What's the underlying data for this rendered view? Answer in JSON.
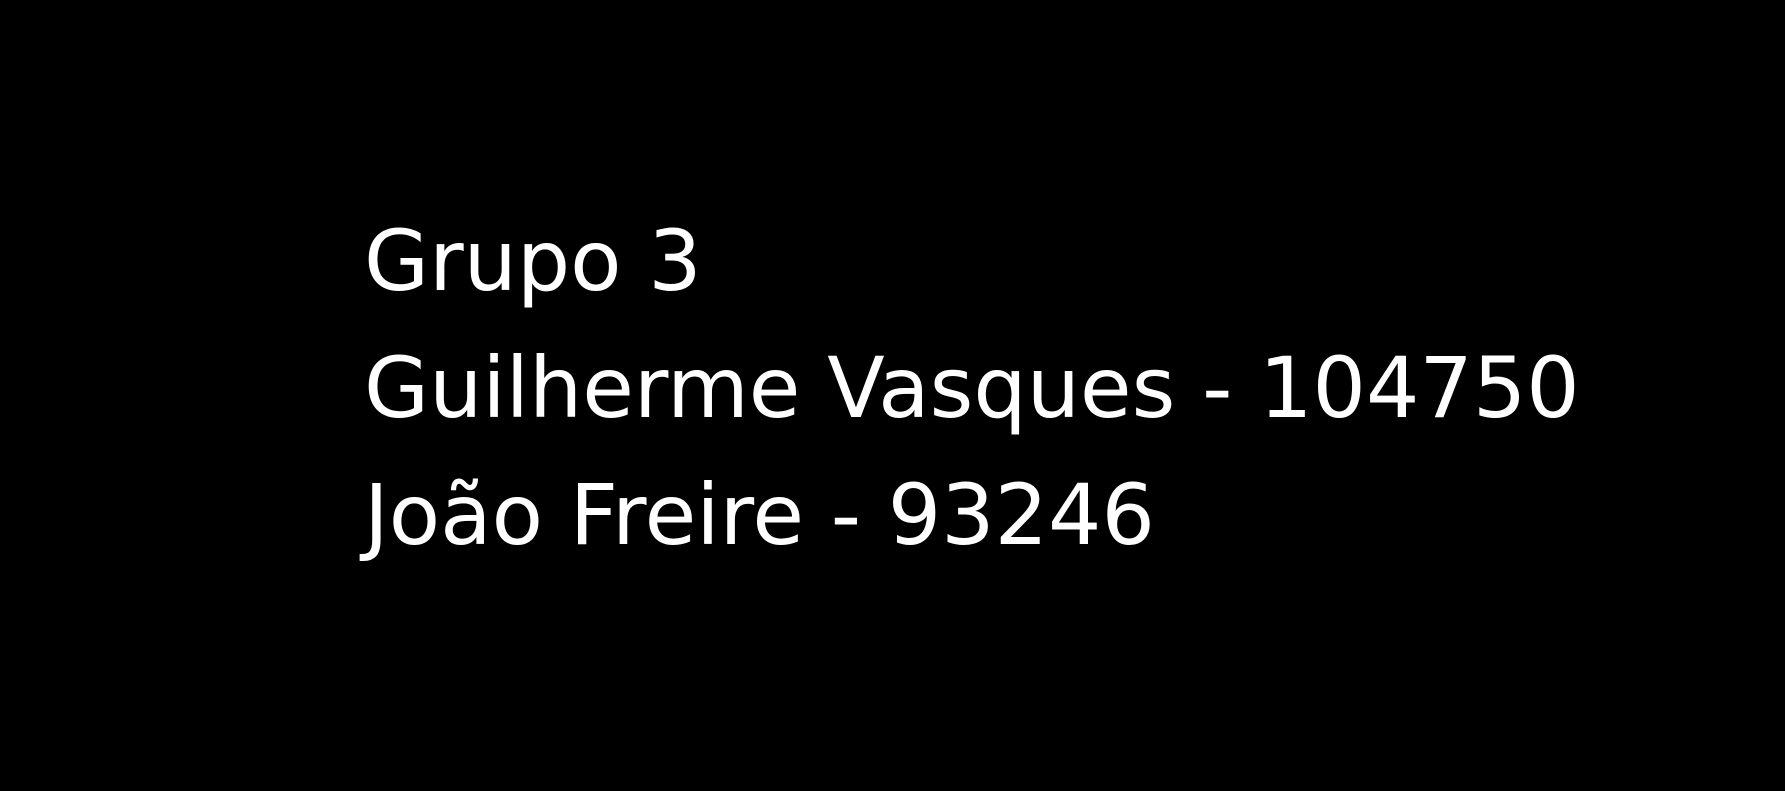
{
  "background_color": "#000000",
  "text_color": "#ffffff",
  "lines": [
    "Grupo 3",
    "Guilherme Vasques - 104750",
    "João Freire - 93246"
  ]
}
